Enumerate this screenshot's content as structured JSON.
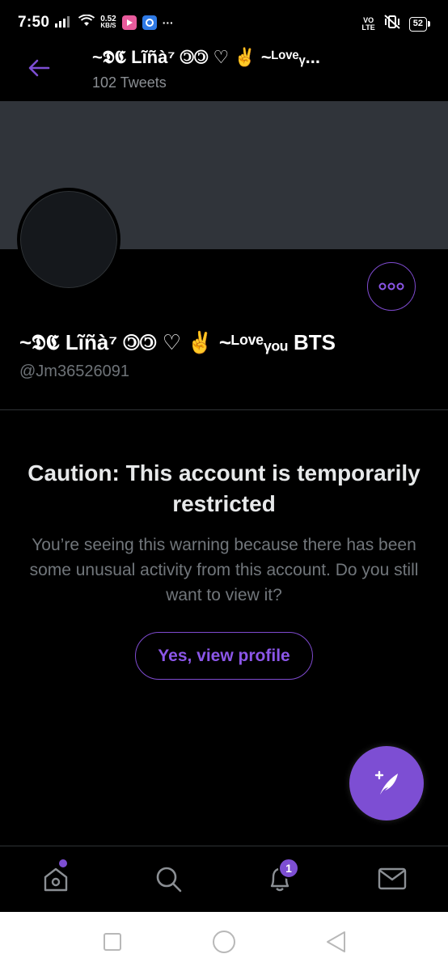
{
  "status_bar": {
    "time": "7:50",
    "net_speed_value": "0.52",
    "net_speed_unit": "KB/S",
    "more_dots": "···",
    "volte_top": "VO",
    "volte_bottom": "LTE",
    "battery": "52"
  },
  "header": {
    "title": "~𝕯𝕮 Lĩñà⁷ 🄯🄯 ♡ ✌️ ~ᴸᵒᵛᵉᵧ...",
    "tweet_count": "102 Tweets"
  },
  "profile": {
    "display_name": "~𝕯𝕮 Lĩñà⁷ 🄯🄯 ♡ ✌️ ~ᴸᵒᵛᵉᵧₒᵤ BTS",
    "handle": "@Jm36526091"
  },
  "caution": {
    "title": "Caution: This account is temporarily restricted",
    "body": "You’re seeing this warning because there has been some unusual activity from this account. Do you still want to view it?",
    "button_label": "Yes, view profile"
  },
  "bottom_nav": {
    "notifications_badge": "1"
  },
  "colors": {
    "accent": "#7d4ed3",
    "banner": "#30343a",
    "secondary_text": "#71767b"
  }
}
